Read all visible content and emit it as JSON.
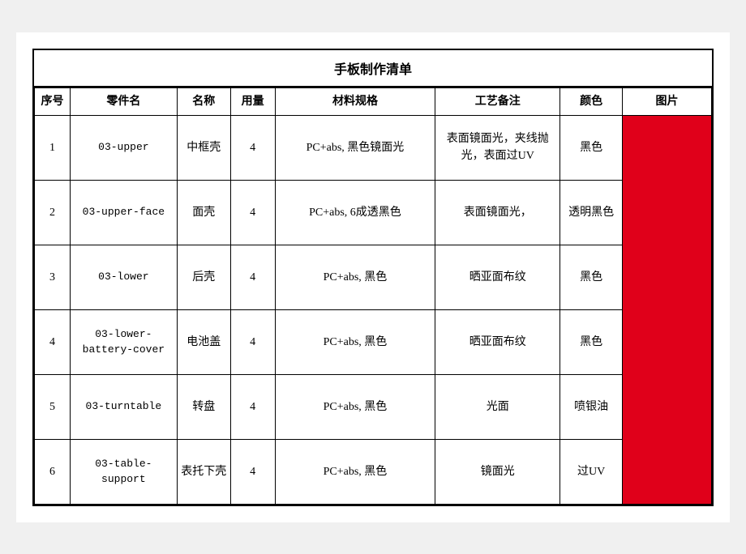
{
  "title": "手板制作清单",
  "headers": {
    "seq": "序号",
    "part_code": "零件名",
    "name": "名称",
    "qty": "用量",
    "spec": "材料规格",
    "process": "工艺备注",
    "color": "颜色",
    "image": "图片"
  },
  "rows": [
    {
      "seq": "1",
      "part_code": "03-upper",
      "name": "中框壳",
      "qty": "4",
      "spec": "PC+abs, 黑色镜面光",
      "process": "表面镜面光，夹线抛光，表面过UV",
      "color": "黑色"
    },
    {
      "seq": "2",
      "part_code": "03-upper-face",
      "name": "面壳",
      "qty": "4",
      "spec": "PC+abs, 6成透黑色",
      "process": "表面镜面光，",
      "color": "透明黑色"
    },
    {
      "seq": "3",
      "part_code": "03-lower",
      "name": "后壳",
      "qty": "4",
      "spec": "PC+abs, 黑色",
      "process": "晒亚面布纹",
      "color": "黑色"
    },
    {
      "seq": "4",
      "part_code": "03-lower-battery-cover",
      "name": "电池盖",
      "qty": "4",
      "spec": "PC+abs, 黑色",
      "process": "晒亚面布纹",
      "color": "黑色"
    },
    {
      "seq": "5",
      "part_code": "03-turntable",
      "name": "转盘",
      "qty": "4",
      "spec": "PC+abs, 黑色",
      "process": "光面",
      "color": "喷银油"
    },
    {
      "seq": "6",
      "part_code": "03-table-support",
      "name": "表托下壳",
      "qty": "4",
      "spec": "PC+abs, 黑色",
      "process": "镜面光",
      "color": "过UV"
    }
  ],
  "colors": {
    "red_block": "#e0001a"
  }
}
